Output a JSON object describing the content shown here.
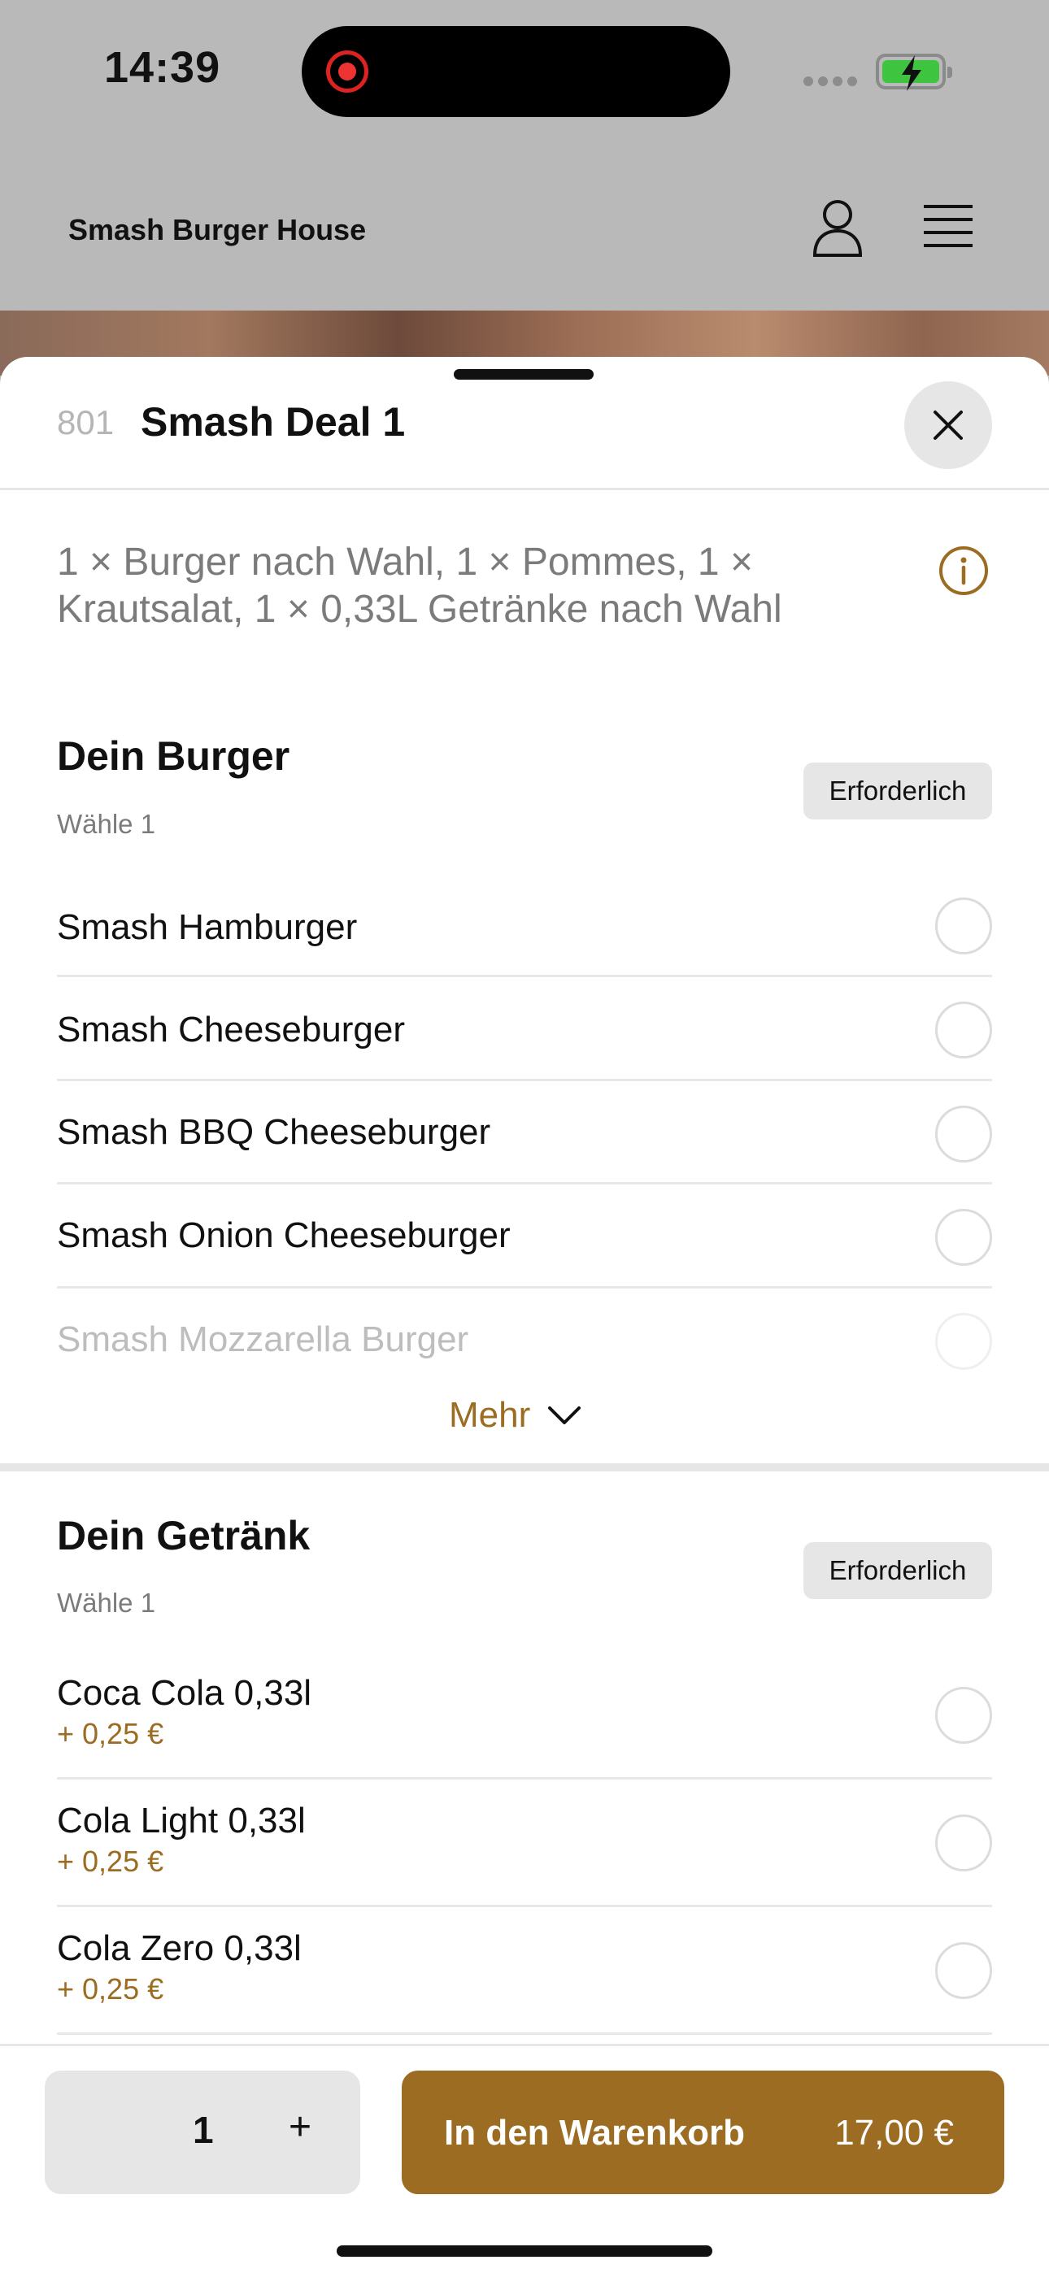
{
  "status_bar": {
    "time": "14:39"
  },
  "header": {
    "brand": "Smash Burger House"
  },
  "sheet": {
    "item_number": "801",
    "title": "Smash Deal 1",
    "description": "1 × Burger nach Wahl, 1 × Pommes, 1 × Krautsalat, 1 × 0,33L Getränke nach Wahl"
  },
  "groups": [
    {
      "title": "Dein Burger",
      "subtitle": "Wähle 1",
      "badge": "Erforderlich",
      "options": [
        {
          "label": "Smash Hamburger"
        },
        {
          "label": "Smash Cheeseburger"
        },
        {
          "label": "Smash BBQ Cheeseburger"
        },
        {
          "label": "Smash Onion Cheeseburger"
        },
        {
          "label": "Smash Mozzarella Burger"
        }
      ],
      "more_label": "Mehr"
    },
    {
      "title": "Dein Getränk",
      "subtitle": "Wähle 1",
      "badge": "Erforderlich",
      "options": [
        {
          "label": "Coca Cola 0,33l",
          "price": "+ 0,25 €"
        },
        {
          "label": "Cola Light 0,33l",
          "price": "+ 0,25 €"
        },
        {
          "label": "Cola Zero 0,33l",
          "price": "+ 0,25 €"
        }
      ]
    }
  ],
  "footer": {
    "quantity": "1",
    "plus": "+",
    "cart_label": "In den Warenkorb",
    "cart_price": "17,00 €"
  },
  "colors": {
    "accent": "#9b6c22",
    "badge_bg": "#e6e6e6",
    "overlay": "#b9b9b9"
  }
}
